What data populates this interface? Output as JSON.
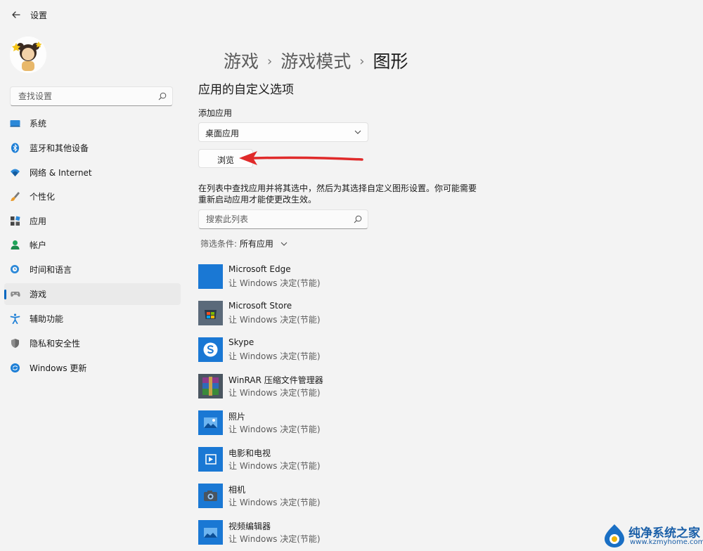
{
  "window": {
    "title": "设置"
  },
  "sidebar": {
    "search_placeholder": "查找设置",
    "items": [
      {
        "label": "系统",
        "icon": "display-icon"
      },
      {
        "label": "蓝牙和其他设备",
        "icon": "bluetooth-icon"
      },
      {
        "label": "网络 & Internet",
        "icon": "wifi-icon"
      },
      {
        "label": "个性化",
        "icon": "brush-icon"
      },
      {
        "label": "应用",
        "icon": "apps-icon"
      },
      {
        "label": "帐户",
        "icon": "person-icon"
      },
      {
        "label": "时间和语言",
        "icon": "globe-clock-icon"
      },
      {
        "label": "游戏",
        "icon": "gamepad-icon",
        "selected": true
      },
      {
        "label": "辅助功能",
        "icon": "accessibility-icon"
      },
      {
        "label": "隐私和安全性",
        "icon": "shield-icon"
      },
      {
        "label": "Windows 更新",
        "icon": "update-icon"
      }
    ]
  },
  "breadcrumb": [
    "游戏",
    "游戏模式",
    "图形"
  ],
  "main": {
    "section_title": "应用的自定义选项",
    "add_app_label": "添加应用",
    "app_type_value": "桌面应用",
    "browse_label": "浏览",
    "description": "在列表中查找应用并将其选中，然后为其选择自定义图形设置。你可能需要重新启动应用才能使更改生效。",
    "list_search_placeholder": "搜索此列表",
    "filter_label": "筛选条件:",
    "filter_value": "所有应用",
    "apps": [
      {
        "name": "Microsoft Edge",
        "status": "让 Windows 决定(节能)",
        "icon": "edge-tile-icon"
      },
      {
        "name": "Microsoft Store",
        "status": "让 Windows 决定(节能)",
        "icon": "store-icon"
      },
      {
        "name": "Skype",
        "status": "让 Windows 决定(节能)",
        "icon": "skype-icon"
      },
      {
        "name": "WinRAR 压缩文件管理器",
        "status": "让 Windows 决定(节能)",
        "icon": "winrar-icon"
      },
      {
        "name": "照片",
        "status": "让 Windows 决定(节能)",
        "icon": "photos-icon"
      },
      {
        "name": "电影和电视",
        "status": "让 Windows 决定(节能)",
        "icon": "movies-icon"
      },
      {
        "name": "相机",
        "status": "让 Windows 决定(节能)",
        "icon": "camera-icon"
      },
      {
        "name": "视频编辑器",
        "status": "让 Windows 决定(节能)",
        "icon": "video-editor-icon"
      }
    ]
  },
  "watermark": {
    "text": "纯净系统之家",
    "url": "www.kzmyhome.com"
  },
  "colors": {
    "accent": "#0067c0",
    "tile": "#1a78d4",
    "arrow": "#e02a2a",
    "background": "#f3f3f3"
  }
}
